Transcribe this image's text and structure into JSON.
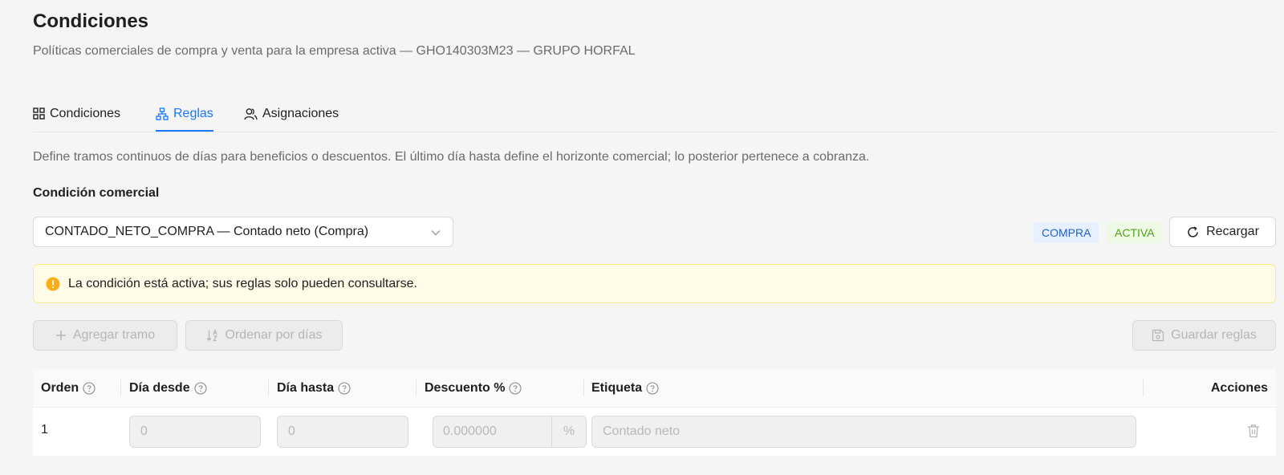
{
  "header": {
    "title": "Condiciones",
    "subtitle": "Políticas comerciales de compra y venta para la empresa activa — GHO140303M23 — GRUPO HORFAL"
  },
  "tabs": [
    {
      "label": "Condiciones",
      "icon": "grid-icon",
      "active": false
    },
    {
      "label": "Reglas",
      "icon": "hierarchy-icon",
      "active": true
    },
    {
      "label": "Asignaciones",
      "icon": "users-icon",
      "active": false
    }
  ],
  "description": "Define tramos continuos de días para beneficios o descuentos. El último día hasta define el horizonte comercial; lo posterior pertenece a cobranza.",
  "condition_field": {
    "label": "Condición comercial",
    "selected": "CONTADO_NETO_COMPRA — Contado neto (Compra)"
  },
  "tags": {
    "type": "COMPRA",
    "status": "ACTIVA"
  },
  "reload_button": "Recargar",
  "alert": {
    "text": "La condición está activa; sus reglas solo pueden consultarse.",
    "color": "#faad14"
  },
  "toolbar": {
    "add_label": "Agregar tramo",
    "sort_label": "Ordenar por días",
    "save_label": "Guardar reglas"
  },
  "table": {
    "columns": {
      "order": "Orden",
      "from": "Día desde",
      "to": "Día hasta",
      "discount": "Descuento %",
      "label": "Etiqueta",
      "actions": "Acciones"
    },
    "rows": [
      {
        "order": "1",
        "from": "0",
        "to": "0",
        "discount": "0.000000",
        "discount_suffix": "%",
        "label_placeholder": "Contado neto"
      }
    ]
  },
  "colors": {
    "accent": "#1677ff",
    "background": "#f5f5f5",
    "alert_bg": "#fffbe6",
    "alert_border": "#ffe58f",
    "tag_compra": "#1f5fd1",
    "tag_activa": "#52a11a"
  }
}
